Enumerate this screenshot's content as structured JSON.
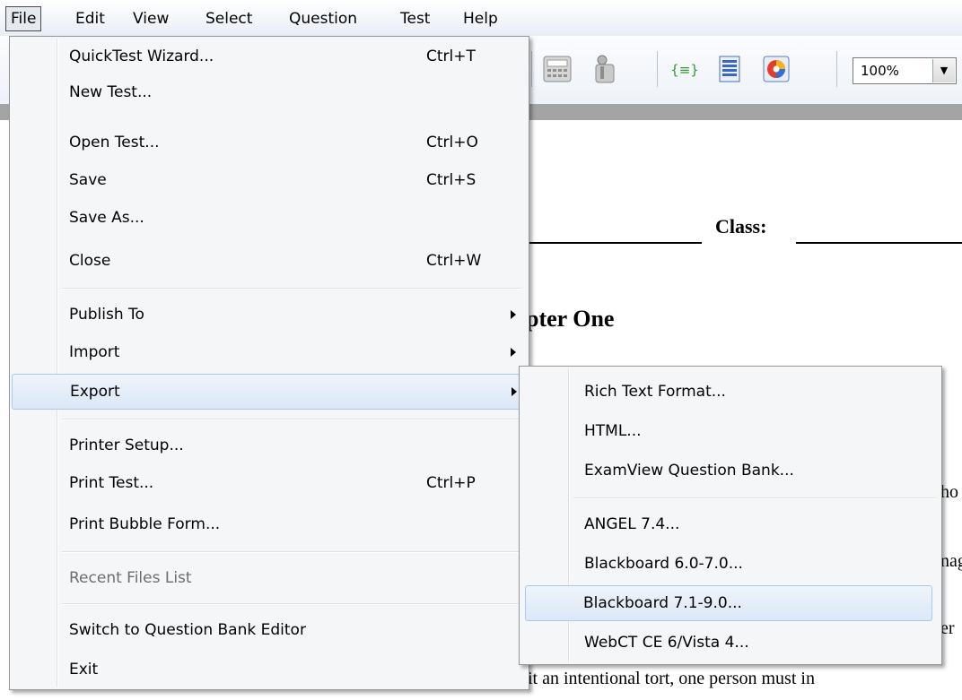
{
  "menubar": {
    "items": [
      "File",
      "Edit",
      "View",
      "Select",
      "Question",
      "Test",
      "Help"
    ]
  },
  "toolbar": {
    "icons": [
      "calculator-icon",
      "info-icon",
      "equation-icon",
      "list-icon",
      "color-wheel-icon"
    ],
    "zoom_value": "100%"
  },
  "document": {
    "class_label": "Class:",
    "chapter_title_fragment": "pter One",
    "line_fragments": [
      "ho",
      "nag",
      "er"
    ],
    "bottom_text": "it an intentional tort, one person must in"
  },
  "file_menu": {
    "items": [
      {
        "label": "QuickTest Wizard...",
        "shortcut": "Ctrl+T"
      },
      {
        "label": "New Test...",
        "shortcut": ""
      },
      {
        "label": "Open Test...",
        "shortcut": "Ctrl+O"
      },
      {
        "label": "Save",
        "shortcut": "Ctrl+S"
      },
      {
        "label": "Save As...",
        "shortcut": ""
      },
      {
        "label": "Close",
        "shortcut": "Ctrl+W"
      },
      {
        "label": "Publish To",
        "shortcut": ""
      },
      {
        "label": "Import",
        "shortcut": ""
      },
      {
        "label": "Export",
        "shortcut": ""
      },
      {
        "label": "Printer Setup...",
        "shortcut": ""
      },
      {
        "label": "Print Test...",
        "shortcut": "Ctrl+P"
      },
      {
        "label": "Print Bubble Form...",
        "shortcut": ""
      },
      {
        "label": "Recent Files List",
        "shortcut": ""
      },
      {
        "label": "Switch to Question Bank Editor",
        "shortcut": ""
      },
      {
        "label": "Exit",
        "shortcut": ""
      }
    ]
  },
  "export_menu": {
    "items": [
      "Rich Text Format...",
      "HTML...",
      "ExamView Question Bank...",
      "ANGEL 7.4...",
      "Blackboard 6.0-7.0...",
      "Blackboard 7.1-9.0...",
      "WebCT CE 6/Vista 4..."
    ]
  }
}
